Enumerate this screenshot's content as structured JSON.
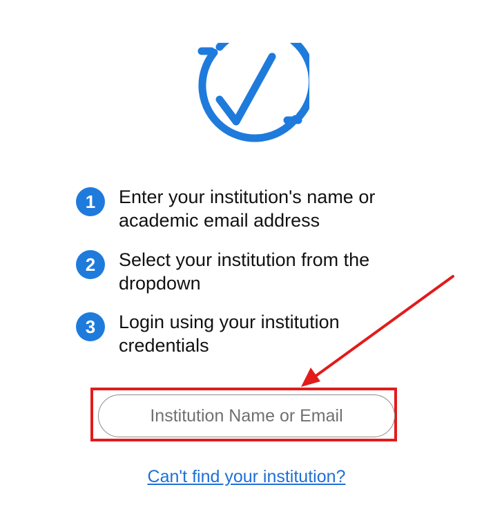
{
  "logo": {
    "icon": "circular-checkmark-icon",
    "color": "#1e7bdc"
  },
  "steps": [
    {
      "number": "1",
      "text": "Enter your institution's name or academic email address"
    },
    {
      "number": "2",
      "text": "Select your institution from the dropdown"
    },
    {
      "number": "3",
      "text": "Login using your institution credentials"
    }
  ],
  "search": {
    "placeholder": "Institution Name or Email",
    "value": ""
  },
  "annotation": {
    "highlight_color": "#e21b1b",
    "arrow_icon": "red-arrow-icon"
  },
  "help_link": {
    "label": "Can't find your institution?"
  }
}
